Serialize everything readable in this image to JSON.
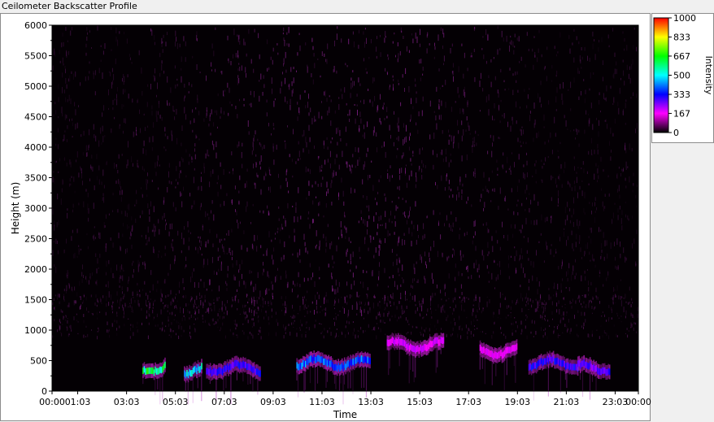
{
  "window": {
    "title": "Ceilometer Backscatter Profile"
  },
  "chart_data": {
    "type": "heatmap",
    "title": "Ceilometer Backscatter Profile",
    "xlabel": "Time",
    "ylabel": "Height (m)",
    "xlim": [
      0,
      24
    ],
    "ylim": [
      0,
      6000
    ],
    "x_tick_labels": [
      "00:00",
      "01:03",
      "03:03",
      "05:03",
      "07:03",
      "09:03",
      "11:03",
      "13:03",
      "15:03",
      "17:03",
      "19:03",
      "21:03",
      "23:03",
      "00:00"
    ],
    "x_tick_values": [
      0,
      1.05,
      3.05,
      5.05,
      7.05,
      9.05,
      11.05,
      13.05,
      15.05,
      17.05,
      19.05,
      21.05,
      23.05,
      24
    ],
    "y_ticks": [
      0,
      500,
      1000,
      1500,
      2000,
      2500,
      3000,
      3500,
      4000,
      4500,
      5000,
      5500,
      6000
    ],
    "colorbar": {
      "label": "Intensity",
      "range": [
        0,
        1000
      ],
      "tick_values": [
        0,
        167,
        333,
        500,
        667,
        833,
        1000
      ],
      "tick_labels": [
        "0",
        "167",
        "333",
        "500",
        "667",
        "833",
        "1000"
      ]
    },
    "features": [
      {
        "name": "cloud-layer",
        "x_start": 3.7,
        "x_end": 4.6,
        "height": 380,
        "intensity": 640
      },
      {
        "name": "cloud-layer",
        "x_start": 5.4,
        "x_end": 6.1,
        "height": 330,
        "intensity": 520
      },
      {
        "name": "cloud-layer",
        "x_start": 6.3,
        "x_end": 8.5,
        "height": 370,
        "intensity": 330
      },
      {
        "name": "cloud-layer",
        "x_start": 10.0,
        "x_end": 13.0,
        "height": 460,
        "intensity": 420
      },
      {
        "name": "cloud-layer",
        "x_start": 13.7,
        "x_end": 16.0,
        "height": 750,
        "intensity": 200
      },
      {
        "name": "cloud-layer",
        "x_start": 17.5,
        "x_end": 19.0,
        "height": 650,
        "intensity": 180
      },
      {
        "name": "cloud-layer",
        "x_start": 19.5,
        "x_end": 21.5,
        "height": 450,
        "intensity": 330
      },
      {
        "name": "cloud-layer",
        "x_start": 21.5,
        "x_end": 22.8,
        "height": 380,
        "intensity": 300
      }
    ],
    "grid": false,
    "legend": "right"
  },
  "colors": {
    "plot_background": "#040004",
    "noise": "#c030c8",
    "colormap": [
      "#000000",
      "#ff00ff",
      "#0000ff",
      "#00ffff",
      "#00ff00",
      "#ffff00",
      "#ff0000"
    ]
  }
}
